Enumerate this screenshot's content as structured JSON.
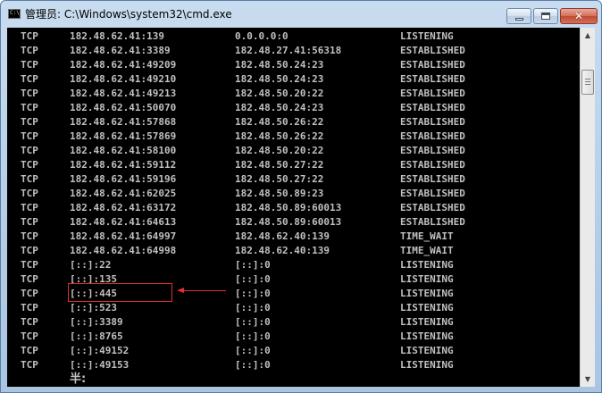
{
  "window": {
    "title": "管理员: C:\\Windows\\system32\\cmd.exe",
    "icon_text": "C:\\",
    "buttons": {
      "minimize": "minimize-icon",
      "maximize": "maximize-icon",
      "close": "✕"
    }
  },
  "console": {
    "rows": [
      {
        "proto": "TCP",
        "local": "182.48.62.41:139",
        "foreign": "0.0.0.0:0",
        "state": "LISTENING"
      },
      {
        "proto": "TCP",
        "local": "182.48.62.41:3389",
        "foreign": "182.48.27.41:56318",
        "state": "ESTABLISHED"
      },
      {
        "proto": "TCP",
        "local": "182.48.62.41:49209",
        "foreign": "182.48.50.24:23",
        "state": "ESTABLISHED"
      },
      {
        "proto": "TCP",
        "local": "182.48.62.41:49210",
        "foreign": "182.48.50.24:23",
        "state": "ESTABLISHED"
      },
      {
        "proto": "TCP",
        "local": "182.48.62.41:49213",
        "foreign": "182.48.50.20:22",
        "state": "ESTABLISHED"
      },
      {
        "proto": "TCP",
        "local": "182.48.62.41:50070",
        "foreign": "182.48.50.24:23",
        "state": "ESTABLISHED"
      },
      {
        "proto": "TCP",
        "local": "182.48.62.41:57868",
        "foreign": "182.48.50.26:22",
        "state": "ESTABLISHED"
      },
      {
        "proto": "TCP",
        "local": "182.48.62.41:57869",
        "foreign": "182.48.50.26:22",
        "state": "ESTABLISHED"
      },
      {
        "proto": "TCP",
        "local": "182.48.62.41:58100",
        "foreign": "182.48.50.20:22",
        "state": "ESTABLISHED"
      },
      {
        "proto": "TCP",
        "local": "182.48.62.41:59112",
        "foreign": "182.48.50.27:22",
        "state": "ESTABLISHED"
      },
      {
        "proto": "TCP",
        "local": "182.48.62.41:59196",
        "foreign": "182.48.50.27:22",
        "state": "ESTABLISHED"
      },
      {
        "proto": "TCP",
        "local": "182.48.62.41:62025",
        "foreign": "182.48.50.89:23",
        "state": "ESTABLISHED"
      },
      {
        "proto": "TCP",
        "local": "182.48.62.41:63172",
        "foreign": "182.48.50.89:60013",
        "state": "ESTABLISHED"
      },
      {
        "proto": "TCP",
        "local": "182.48.62.41:64613",
        "foreign": "182.48.50.89:60013",
        "state": "ESTABLISHED"
      },
      {
        "proto": "TCP",
        "local": "182.48.62.41:64997",
        "foreign": "182.48.62.40:139",
        "state": "TIME_WAIT"
      },
      {
        "proto": "TCP",
        "local": "182.48.62.41:64998",
        "foreign": "182.48.62.40:139",
        "state": "TIME_WAIT"
      },
      {
        "proto": "TCP",
        "local": "[::]:22",
        "foreign": "[::]:0",
        "state": "LISTENING"
      },
      {
        "proto": "TCP",
        "local": "[::]:135",
        "foreign": "[::]:0",
        "state": "LISTENING"
      },
      {
        "proto": "TCP",
        "local": "[::]:445",
        "foreign": "[::]:0",
        "state": "LISTENING"
      },
      {
        "proto": "TCP",
        "local": "[::]:523",
        "foreign": "[::]:0",
        "state": "LISTENING"
      },
      {
        "proto": "TCP",
        "local": "[::]:3389",
        "foreign": "[::]:0",
        "state": "LISTENING"
      },
      {
        "proto": "TCP",
        "local": "[::]:8765",
        "foreign": "[::]:0",
        "state": "LISTENING"
      },
      {
        "proto": "TCP",
        "local": "[::]:49152",
        "foreign": "[::]:0",
        "state": "LISTENING"
      },
      {
        "proto": "TCP",
        "local": "[::]:49153",
        "foreign": "[::]:0",
        "state": "LISTENING"
      }
    ],
    "prompt_partial": "半:",
    "annotation_color": "#e03030"
  },
  "colors": {
    "console_bg": "#000000",
    "console_text": "#c0c0c0",
    "close_button": "#c14a31"
  }
}
